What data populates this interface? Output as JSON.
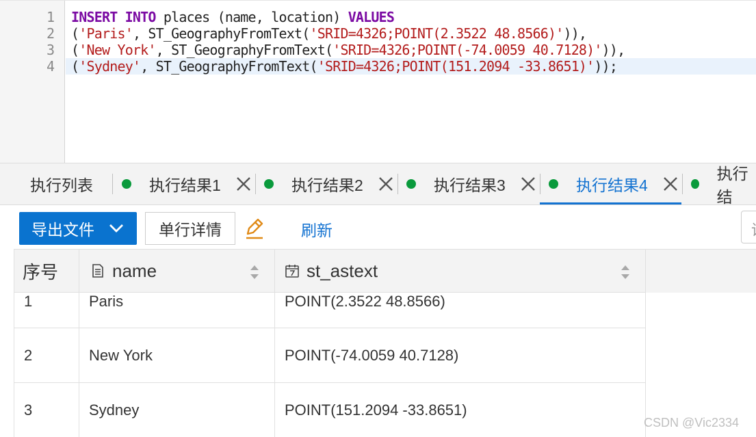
{
  "editor": {
    "line_numbers": [
      "1",
      "2",
      "3",
      "4"
    ],
    "lines": [
      {
        "kw1": "INSERT INTO",
        "plain1": " places (name, location) ",
        "kw2": "VALUES"
      },
      {
        "open": "(",
        "str1": "'Paris'",
        "mid": ", ST_GeographyFromText(",
        "str2": "'SRID=4326;POINT(2.3522 48.8566)'",
        "close": ")),"
      },
      {
        "open": "(",
        "str1": "'New York'",
        "mid": ", ST_GeographyFromText(",
        "str2": "'SRID=4326;POINT(-74.0059 40.7128)'",
        "close": ")),"
      },
      {
        "open": "(",
        "str1": "'Sydney'",
        "mid": ", ST_GeographyFromText(",
        "str2": "'SRID=4326;POINT(151.2094 -33.8651)'",
        "close": "));"
      }
    ]
  },
  "tabs": {
    "items": [
      {
        "label": "执行列表",
        "has_dot": false,
        "closable": false,
        "active": false
      },
      {
        "label": "执行结果1",
        "has_dot": true,
        "closable": true,
        "active": false
      },
      {
        "label": "执行结果2",
        "has_dot": true,
        "closable": true,
        "active": false
      },
      {
        "label": "执行结果3",
        "has_dot": true,
        "closable": true,
        "active": false
      },
      {
        "label": "执行结果4",
        "has_dot": true,
        "closable": true,
        "active": true
      },
      {
        "label": "执行结",
        "has_dot": true,
        "closable": false,
        "active": false
      }
    ],
    "dot_color": "#0a9a3c",
    "active_color": "#1473d1"
  },
  "toolbar": {
    "export_label": "导出文件",
    "detail_label": "单行详情",
    "refresh_label": "刷新",
    "edit_icon": "pencil-edit-icon",
    "search_partial": "请"
  },
  "grid": {
    "columns": [
      {
        "label": "序号",
        "icon": null
      },
      {
        "label": "name",
        "icon": "document-icon"
      },
      {
        "label": "st_astext",
        "icon": "calendar-icon"
      }
    ],
    "rows": [
      {
        "index": "1",
        "name": "Paris",
        "st_astext": "POINT(2.3522 48.8566)"
      },
      {
        "index": "2",
        "name": "New York",
        "st_astext": "POINT(-74.0059 40.7128)"
      },
      {
        "index": "3",
        "name": "Sydney",
        "st_astext": "POINT(151.2094 -33.8651)"
      }
    ]
  },
  "watermark": "CSDN @Vic2334",
  "colors": {
    "primary": "#0a73cf",
    "link": "#1473d1",
    "keyword": "#7b0aa3",
    "string": "#b31c1c"
  }
}
